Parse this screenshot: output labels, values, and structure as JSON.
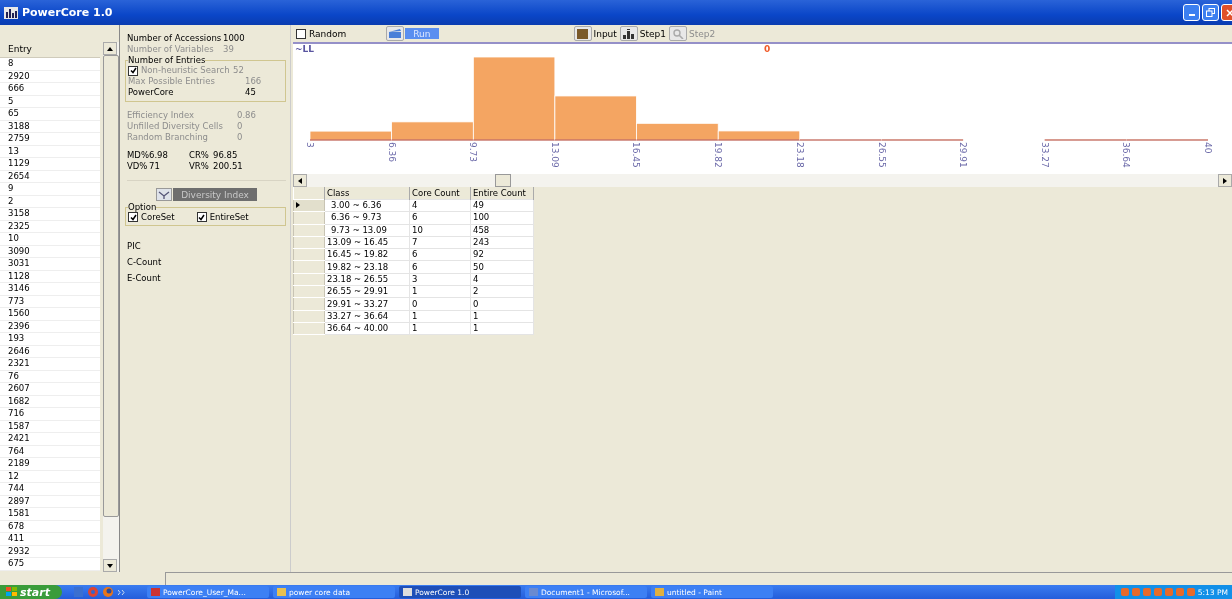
{
  "window": {
    "title": "PowerCore 1.0"
  },
  "entry_list": {
    "header": "Entry",
    "rows": [
      "8",
      "2920",
      "666",
      "5",
      "65",
      "3188",
      "2759",
      "13",
      "1129",
      "2654",
      "9",
      "2",
      "3158",
      "2325",
      "10",
      "3090",
      "3031",
      "1128",
      "3146",
      "773",
      "1560",
      "2396",
      "193",
      "2646",
      "2321",
      "76",
      "2607",
      "1682",
      "716",
      "1587",
      "2421",
      "764",
      "2189",
      "12",
      "744",
      "2897",
      "1581",
      "678",
      "411",
      "2932",
      "675"
    ]
  },
  "summary": [
    {
      "label": "Number of Accessions",
      "value": "1000",
      "disabled": false
    },
    {
      "label": "Number of Variables",
      "value": "39",
      "disabled": true
    }
  ],
  "entries_group": {
    "title": "Number of Entries",
    "items": [
      {
        "kind": "checkbox",
        "label": "Non-heuristic Search",
        "value": "52",
        "checked": true,
        "disabled": true
      },
      {
        "kind": "text",
        "label": "Max Possible Entries",
        "value": "166",
        "disabled": true
      },
      {
        "kind": "text",
        "label": "PowerCore",
        "value": "45",
        "disabled": false
      }
    ]
  },
  "indices": [
    {
      "label": "Efficiency Index",
      "value": "0.86",
      "disabled": true
    },
    {
      "label": "Unfilled Diversity Cells",
      "value": "0",
      "disabled": true
    },
    {
      "label": "Random Branching",
      "value": "0",
      "disabled": true
    }
  ],
  "percentages": [
    {
      "label": "MD%",
      "value": "6.98"
    },
    {
      "label": "CR%",
      "value": "96.85"
    },
    {
      "label": "VD%",
      "value": "71"
    },
    {
      "label": "VR%",
      "value": "200.51"
    }
  ],
  "diversity_button": {
    "label": "Diversity Index",
    "disabled": true
  },
  "option_group": {
    "title": "Option",
    "options": [
      {
        "label": "CoreSet",
        "checked": true
      },
      {
        "label": "EntireSet",
        "checked": true
      }
    ]
  },
  "measures": [
    "PIC",
    "C-Count",
    "E-Count"
  ],
  "toolbar": {
    "random": {
      "label": "Random",
      "checked": false
    },
    "run": {
      "label": "Run"
    },
    "steps": [
      {
        "label": "Input",
        "disabled": false
      },
      {
        "label": "Step1",
        "disabled": false
      },
      {
        "label": "Step2",
        "disabled": true
      }
    ]
  },
  "chart": {
    "corner_label": "~LL",
    "marker_label": "0",
    "tick_labels": [
      "3",
      "6.36",
      "9.73",
      "13.09",
      "16.45",
      "19.82",
      "23.18",
      "26.55",
      "29.91",
      "33.27",
      "36.64",
      "40"
    ]
  },
  "table": {
    "columns": [
      "Class",
      "Core Count",
      "Entire Count"
    ],
    "rows": [
      {
        "cells": [
          "3.00 ~ 6.36",
          "4",
          "49"
        ],
        "selected": true
      },
      {
        "cells": [
          "6.36 ~ 9.73",
          "6",
          "100"
        ],
        "selected": false
      },
      {
        "cells": [
          "9.73 ~ 13.09",
          "10",
          "458"
        ],
        "selected": false
      },
      {
        "cells": [
          "13.09 ~ 16.45",
          "7",
          "243"
        ],
        "selected": false
      },
      {
        "cells": [
          "16.45 ~ 19.82",
          "6",
          "92"
        ],
        "selected": false
      },
      {
        "cells": [
          "19.82 ~ 23.18",
          "6",
          "50"
        ],
        "selected": false
      },
      {
        "cells": [
          "23.18 ~ 26.55",
          "3",
          "4"
        ],
        "selected": false
      },
      {
        "cells": [
          "26.55 ~ 29.91",
          "1",
          "2"
        ],
        "selected": false
      },
      {
        "cells": [
          "29.91 ~ 33.27",
          "0",
          "0"
        ],
        "selected": false
      },
      {
        "cells": [
          "33.27 ~ 36.64",
          "1",
          "1"
        ],
        "selected": false
      },
      {
        "cells": [
          "36.64 ~ 40.00",
          "1",
          "1"
        ],
        "selected": false
      }
    ]
  },
  "taskbar": {
    "start": "start",
    "tasks": [
      {
        "label": "PowerCore_User_Ma...",
        "selected": false
      },
      {
        "label": "power core data",
        "selected": false
      },
      {
        "label": "PowerCore 1.0",
        "selected": true
      },
      {
        "label": "Document1 - Microsof...",
        "selected": false
      },
      {
        "label": "untitled - Paint",
        "selected": false
      }
    ],
    "clock": "5:13 PM"
  }
}
